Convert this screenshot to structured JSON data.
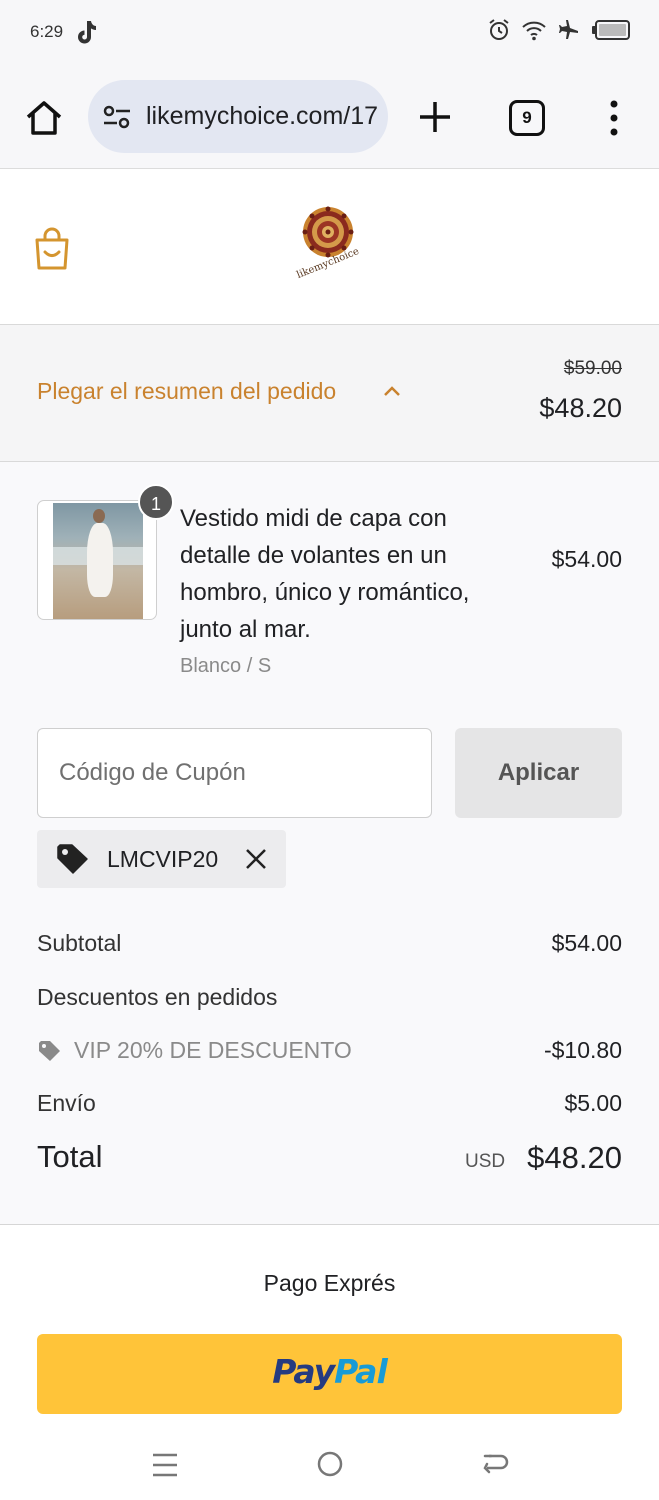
{
  "status_bar": {
    "time": "6:29",
    "battery": "19",
    "icons": [
      "tiktok-icon",
      "alarm-icon",
      "wifi-icon",
      "airplane-icon",
      "battery-icon"
    ]
  },
  "browser": {
    "url": "likemychoice.com/17",
    "tab_count": "9"
  },
  "store": {
    "logo_text": "likemychoice"
  },
  "summary": {
    "toggle_label": "Plegar el resumen del pedido",
    "original_price": "$59.00",
    "total": "$48.20"
  },
  "product": {
    "quantity": "1",
    "title": "Vestido midi de capa con detalle de volantes en un hombro, único y romántico, junto al mar.",
    "variant": "Blanco / S",
    "price": "$54.00"
  },
  "coupon": {
    "placeholder": "Código de Cupón",
    "apply_label": "Aplicar",
    "applied_code": "LMCVIP20"
  },
  "totals": {
    "subtotal_label": "Subtotal",
    "subtotal": "$54.00",
    "discounts_label": "Descuentos en pedidos",
    "discount_name": "VIP 20% DE DESCUENTO",
    "discount_amount": "-$10.80",
    "shipping_label": "Envío",
    "shipping": "$5.00",
    "total_label": "Total",
    "currency": "USD",
    "total": "$48.20"
  },
  "express": {
    "title": "Pago Exprés",
    "paypal_pay": "Pay",
    "paypal_pal": "Pal"
  },
  "colors": {
    "accent": "#c9822e",
    "paypal_yellow": "#ffc439",
    "paypal_dark_blue": "#253b80",
    "paypal_light_blue": "#179bd7"
  }
}
